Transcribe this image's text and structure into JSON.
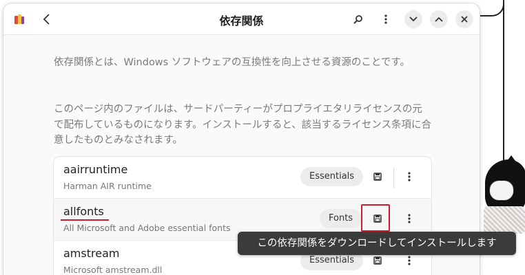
{
  "window": {
    "title": "依存関係",
    "back_label": "〈",
    "icons": [
      "app-icon",
      "back-icon",
      "search-icon",
      "more-icon",
      "chevron-down-icon",
      "chevron-up-icon",
      "close-icon"
    ]
  },
  "content": {
    "intro": "依存関係とは、Windows ソフトウェアの互換性を向上させる資源のことです。",
    "license_note": "このページ内のファイルは、サードパーティーがプロプライエタリライセンスの元で配布しているものになります。インストールすると、該当するライセンス条項に合意したものとみなされます。"
  },
  "dependencies": [
    {
      "name": "aairruntime",
      "description": "Harman AIR runtime",
      "category": "Essentials"
    },
    {
      "name": "allfonts",
      "description": "All Microsoft and Adobe essential fonts",
      "category": "Fonts"
    },
    {
      "name": "amstream",
      "description": "Microsoft amstream.dll",
      "category": "Essentials"
    }
  ],
  "tooltip": "この依存関係をダウンロードしてインストールします",
  "colors": {
    "highlight": "#d11a2a",
    "tooltip_bg": "#3b3b3b",
    "tag_bg": "#ececec"
  }
}
